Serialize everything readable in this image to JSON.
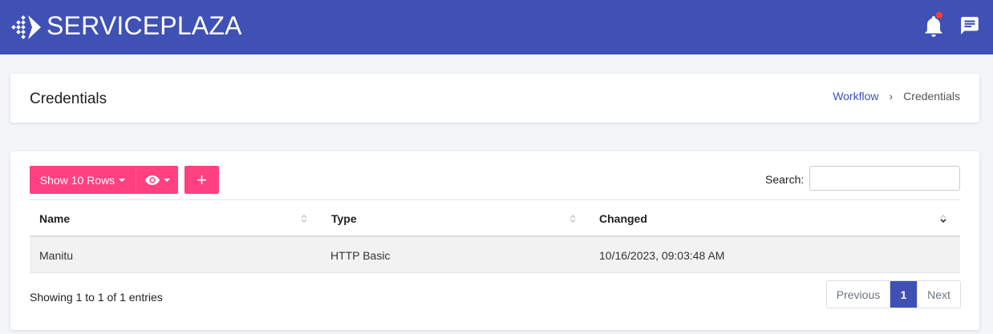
{
  "app": {
    "brand": "SERVICEPLAZA",
    "notification_icon": "bell-icon",
    "chat_icon": "chat-icon",
    "accent_color": "#3f51b5",
    "button_color": "#ff4081"
  },
  "page": {
    "title": "Credentials",
    "breadcrumb": {
      "parent": "Workflow",
      "current": "Credentials"
    }
  },
  "toolbar": {
    "rows_label": "Show 10 Rows",
    "add_label": "+",
    "search_label": "Search:",
    "search_value": ""
  },
  "table": {
    "columns": [
      "Name",
      "Type",
      "Changed"
    ],
    "rows": [
      {
        "name": "Manitu",
        "type": "HTTP Basic",
        "changed": "10/16/2023, 09:03:48 AM"
      }
    ]
  },
  "footer": {
    "info": "Showing 1 to 1 of 1 entries",
    "previous": "Previous",
    "page": "1",
    "next": "Next"
  }
}
